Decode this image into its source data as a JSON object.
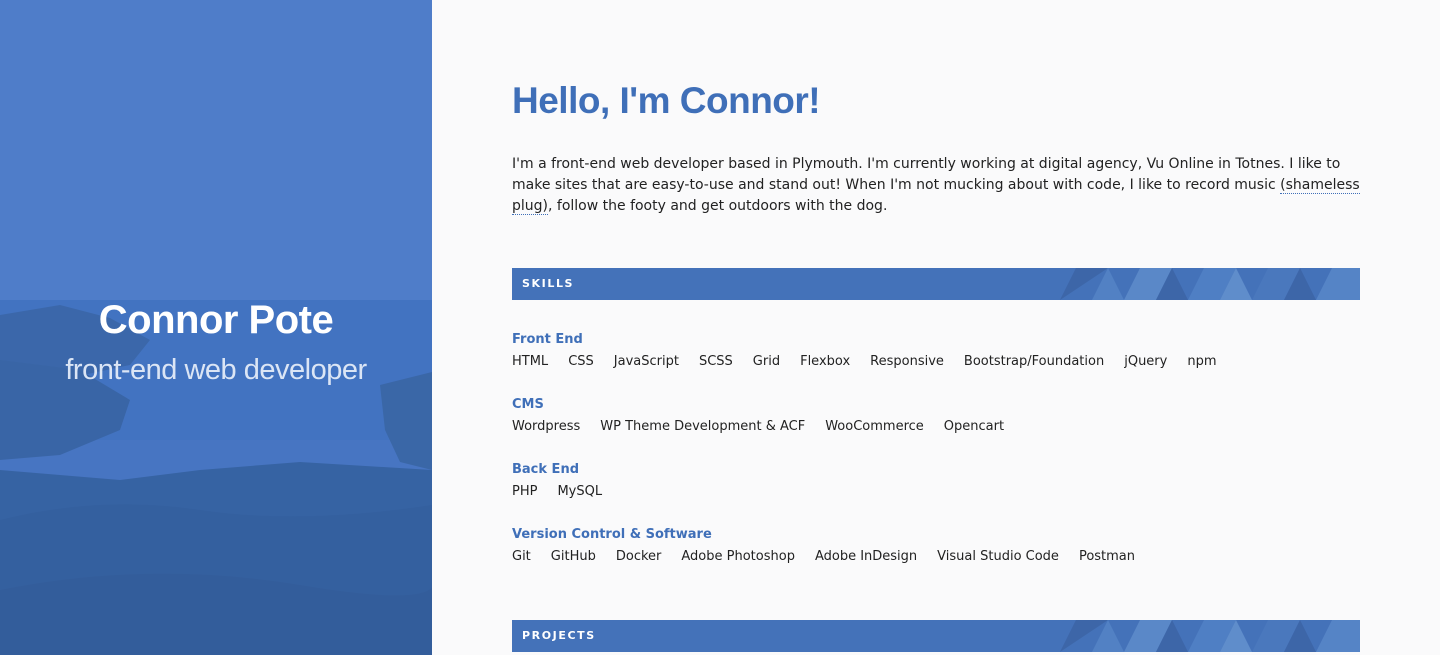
{
  "hero": {
    "name": "Connor Pote",
    "role": "front-end web developer"
  },
  "intro": {
    "greeting": "Hello, I'm Connor!",
    "text_before": "I'm a front-end web developer based in Plymouth. I'm currently working at digital agency, Vu Online in Totnes. I like to make sites that are easy-to-use and stand out! When I'm not mucking about with code, I like to record music ",
    "link": "(shameless plug)",
    "text_after": ", follow the footy and get outdoors with the dog."
  },
  "sections": {
    "skills": "SKILLS",
    "projects": "PROJECTS"
  },
  "skills": [
    {
      "title": "Front End",
      "items": [
        "HTML",
        "CSS",
        "JavaScript",
        "SCSS",
        "Grid",
        "Flexbox",
        "Responsive",
        "Bootstrap/Foundation",
        "jQuery",
        "npm"
      ]
    },
    {
      "title": "CMS",
      "items": [
        "Wordpress",
        "WP Theme Development & ACF",
        "WooCommerce",
        "Opencart"
      ]
    },
    {
      "title": "Back End",
      "items": [
        "PHP",
        "MySQL"
      ]
    },
    {
      "title": "Version Control & Software",
      "items": [
        "Git",
        "GitHub",
        "Docker",
        "Adobe Photoshop",
        "Adobe InDesign",
        "Visual Studio Code",
        "Postman"
      ]
    }
  ],
  "colors": {
    "accent": "#3f6fb8",
    "bar": "#4472b9",
    "hero_overlay": "#4a78c2"
  }
}
